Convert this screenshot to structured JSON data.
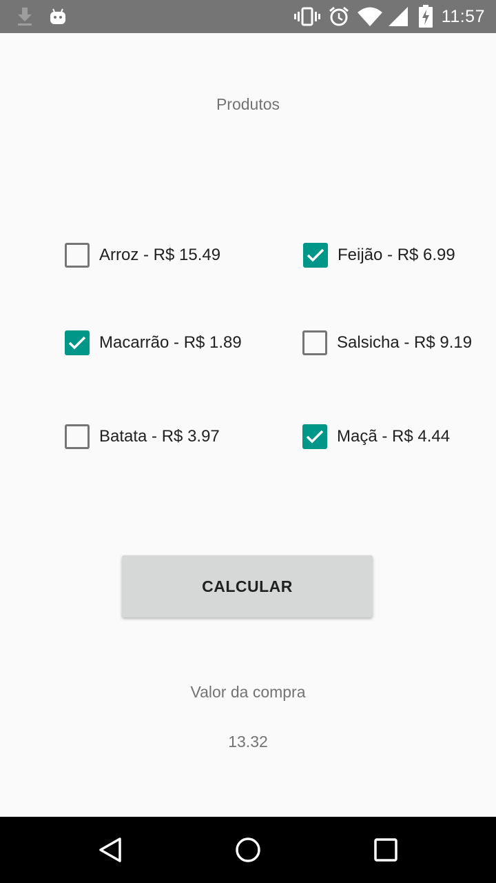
{
  "status_bar": {
    "time": "11:57",
    "icons": [
      "download-icon",
      "android-icon",
      "vibrate-icon",
      "alarm-icon",
      "wifi-icon",
      "signal-icon",
      "battery-icon"
    ]
  },
  "title": "Produtos",
  "products": [
    {
      "label": "Arroz - R$ 15.49",
      "checked": false
    },
    {
      "label": "Feijão - R$ 6.99",
      "checked": true
    },
    {
      "label": "Macarrão - R$ 1.89",
      "checked": true
    },
    {
      "label": "Salsicha - R$ 9.19",
      "checked": false
    },
    {
      "label": "Batata - R$ 3.97",
      "checked": false
    },
    {
      "label": "Maçã - R$ 4.44",
      "checked": true
    }
  ],
  "calculate_button": "CALCULAR",
  "result": {
    "label": "Valor da compra",
    "value": "13.32"
  },
  "colors": {
    "accent": "#009688",
    "status_bar": "#757575",
    "nav_bar": "#000000",
    "background": "#fafafa"
  }
}
